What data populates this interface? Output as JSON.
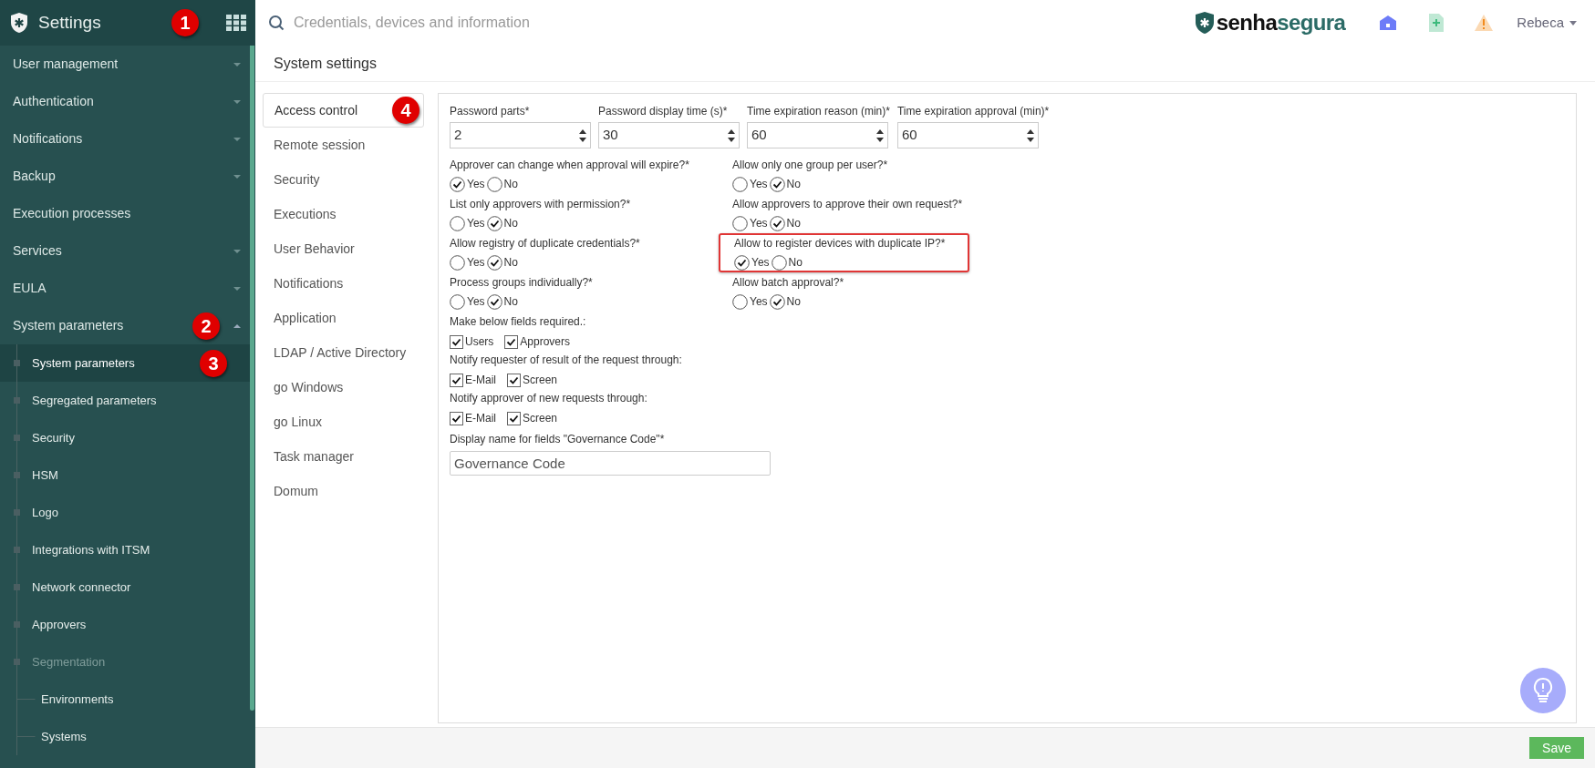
{
  "app": {
    "title": "Settings",
    "badge": "1"
  },
  "search": {
    "placeholder": "Credentials, devices and information"
  },
  "logo": {
    "part_1": "senha",
    "part_2": "segura"
  },
  "user": {
    "name": "Rebeca"
  },
  "sidebar": {
    "items": [
      {
        "label": "User management",
        "kind": "group",
        "expanded": false
      },
      {
        "label": "Authentication",
        "kind": "group",
        "expanded": false
      },
      {
        "label": "Notifications",
        "kind": "group",
        "expanded": false
      },
      {
        "label": "Backup",
        "kind": "group",
        "expanded": false
      },
      {
        "label": "Execution processes",
        "kind": "link"
      },
      {
        "label": "Services",
        "kind": "group",
        "expanded": false
      },
      {
        "label": "EULA",
        "kind": "group",
        "expanded": false
      },
      {
        "label": "System parameters",
        "kind": "group",
        "expanded": true,
        "badge": "2",
        "children": [
          {
            "label": "System parameters",
            "selected": true,
            "disabled": false,
            "badge": "3"
          },
          {
            "label": "Segregated parameters",
            "selected": false,
            "disabled": false
          },
          {
            "label": "Security",
            "selected": false,
            "disabled": false
          },
          {
            "label": "HSM",
            "selected": false,
            "disabled": false
          },
          {
            "label": "Logo",
            "selected": false,
            "disabled": false
          },
          {
            "label": "Integrations with ITSM",
            "selected": false,
            "disabled": false
          },
          {
            "label": "Network connector",
            "selected": false,
            "disabled": false
          },
          {
            "label": "Approvers",
            "selected": false,
            "disabled": false
          },
          {
            "label": "Segmentation",
            "selected": false,
            "disabled": true,
            "children": [
              {
                "label": "Environments",
                "selected": false
              },
              {
                "label": "Systems",
                "selected": false
              }
            ]
          }
        ]
      }
    ]
  },
  "page": {
    "title": "System settings"
  },
  "tabs": [
    {
      "label": "Access control",
      "selected": true,
      "badge": "4"
    },
    {
      "label": "Remote session",
      "selected": false
    },
    {
      "label": "Security",
      "selected": false
    },
    {
      "label": "Executions",
      "selected": false
    },
    {
      "label": "User Behavior",
      "selected": false
    },
    {
      "label": "Notifications",
      "selected": false
    },
    {
      "label": "Application",
      "selected": false
    },
    {
      "label": "LDAP / Active Directory",
      "selected": false
    },
    {
      "label": "go Windows",
      "selected": false
    },
    {
      "label": "go Linux",
      "selected": false
    },
    {
      "label": "Task manager",
      "selected": false
    },
    {
      "label": "Domum",
      "selected": false
    }
  ],
  "form": {
    "number_fields": [
      {
        "label": "Password parts*",
        "value": "2"
      },
      {
        "label": "Password display time (s)*",
        "value": "30"
      },
      {
        "label": "Time expiration reason (min)*",
        "value": "60"
      },
      {
        "label": "Time expiration approval (min)*",
        "value": "60"
      }
    ],
    "choices": [
      {
        "label": "Approver can change when approval will expire?*",
        "highlighted": false,
        "options": [
          {
            "label": "Yes",
            "selected": true
          },
          {
            "label": "No",
            "selected": false
          }
        ]
      },
      {
        "label": "Allow only one group per user?*",
        "highlighted": false,
        "options": [
          {
            "label": "Yes",
            "selected": false
          },
          {
            "label": "No",
            "selected": true
          }
        ]
      },
      {
        "label": "List only approvers with permission?*",
        "highlighted": false,
        "options": [
          {
            "label": "Yes",
            "selected": false
          },
          {
            "label": "No",
            "selected": true
          }
        ]
      },
      {
        "label": "Allow approvers to approve their own request?*",
        "highlighted": false,
        "options": [
          {
            "label": "Yes",
            "selected": false
          },
          {
            "label": "No",
            "selected": true
          }
        ]
      },
      {
        "label": "Allow registry of duplicate credentials?*",
        "highlighted": false,
        "options": [
          {
            "label": "Yes",
            "selected": false
          },
          {
            "label": "No",
            "selected": true
          }
        ]
      },
      {
        "label": "Allow to register devices with duplicate IP?*",
        "highlighted": true,
        "options": [
          {
            "label": "Yes",
            "selected": true
          },
          {
            "label": "No",
            "selected": false
          }
        ]
      },
      {
        "label": "Process groups individually?*",
        "highlighted": false,
        "options": [
          {
            "label": "Yes",
            "selected": false
          },
          {
            "label": "No",
            "selected": true
          }
        ]
      },
      {
        "label": "Allow batch approval?*",
        "highlighted": false,
        "options": [
          {
            "label": "Yes",
            "selected": false
          },
          {
            "label": "No",
            "selected": true
          }
        ]
      }
    ],
    "checkbox_groups": [
      {
        "label": "Make below fields required.:",
        "options": [
          {
            "label": "Users",
            "checked": true
          },
          {
            "label": "Approvers",
            "checked": true
          }
        ]
      },
      {
        "label": "Notify requester of result of the request through:",
        "options": [
          {
            "label": "E-Mail",
            "checked": true
          },
          {
            "label": "Screen",
            "checked": true
          }
        ]
      },
      {
        "label": "Notify approver of new requests through:",
        "options": [
          {
            "label": "E-Mail",
            "checked": true
          },
          {
            "label": "Screen",
            "checked": true
          }
        ]
      }
    ],
    "text_field": {
      "label": "Display name for fields \"Governance Code\"*",
      "value": "Governance Code"
    }
  },
  "save_button": {
    "label": "Save"
  }
}
